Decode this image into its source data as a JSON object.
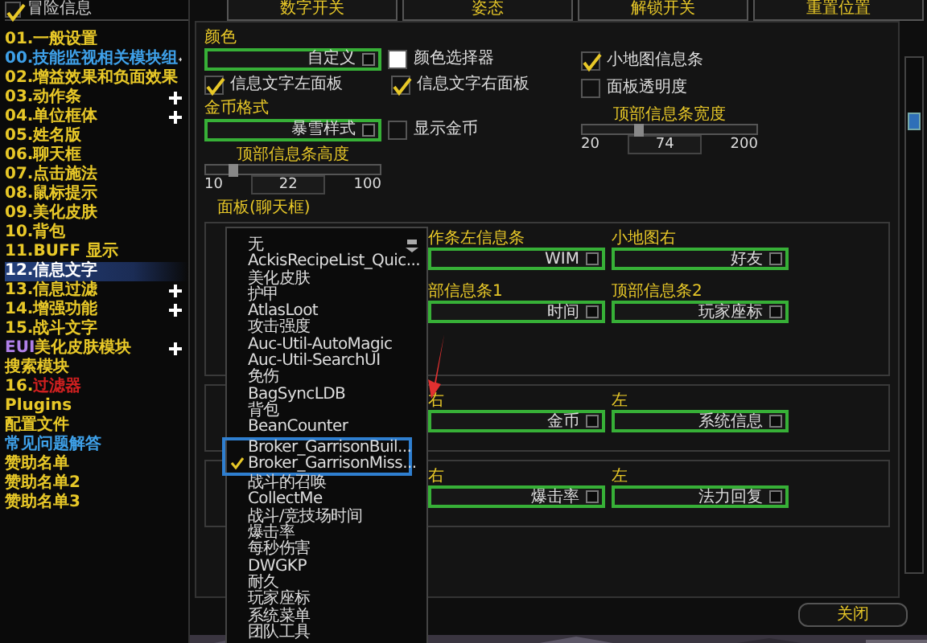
{
  "header": {
    "title": "冒险信息",
    "checked": true
  },
  "tabs": [
    {
      "label": "数字开关"
    },
    {
      "label": "姿态"
    },
    {
      "label": "解锁开关"
    },
    {
      "label": "重置位置"
    }
  ],
  "sidebar": {
    "items": [
      {
        "segments": [
          {
            "text": "01.一般设置",
            "color": "#e8c828"
          }
        ],
        "expandable": false,
        "selected": false
      },
      {
        "segments": [
          {
            "text": "00.技能监视相关模块组",
            "color": "#3ea0e8"
          }
        ],
        "expandable": true,
        "selected": false
      },
      {
        "segments": [
          {
            "text": "02.增益效果和负面效果",
            "color": "#e8c828"
          }
        ],
        "expandable": false,
        "selected": false
      },
      {
        "segments": [
          {
            "text": "03.动作条",
            "color": "#e8c828"
          }
        ],
        "expandable": true,
        "selected": false
      },
      {
        "segments": [
          {
            "text": "04.单位框体",
            "color": "#e8c828"
          }
        ],
        "expandable": true,
        "selected": false
      },
      {
        "segments": [
          {
            "text": "05.姓名版",
            "color": "#e8c828"
          }
        ],
        "expandable": false,
        "selected": false
      },
      {
        "segments": [
          {
            "text": "06.聊天框",
            "color": "#e8c828"
          }
        ],
        "expandable": false,
        "selected": false
      },
      {
        "segments": [
          {
            "text": "07.点击施法",
            "color": "#e8c828"
          }
        ],
        "expandable": false,
        "selected": false
      },
      {
        "segments": [
          {
            "text": "08.鼠标提示",
            "color": "#e8c828"
          }
        ],
        "expandable": false,
        "selected": false
      },
      {
        "segments": [
          {
            "text": "09.美化皮肤",
            "color": "#e8c828"
          }
        ],
        "expandable": false,
        "selected": false
      },
      {
        "segments": [
          {
            "text": "10.背包",
            "color": "#e8c828"
          }
        ],
        "expandable": false,
        "selected": false
      },
      {
        "segments": [
          {
            "text": "11.BUFF 显示",
            "color": "#e8c828"
          }
        ],
        "expandable": false,
        "selected": false
      },
      {
        "segments": [
          {
            "text": "12.信息文字"
          }
        ],
        "expandable": false,
        "selected": true
      },
      {
        "segments": [
          {
            "text": "13.信息过滤",
            "color": "#e8c828"
          }
        ],
        "expandable": true,
        "selected": false
      },
      {
        "segments": [
          {
            "text": "14.增强功能",
            "color": "#e8c828"
          }
        ],
        "expandable": true,
        "selected": false
      },
      {
        "segments": [
          {
            "text": "15.战斗文字",
            "color": "#e8c828"
          }
        ],
        "expandable": false,
        "selected": false
      },
      {
        "segments": [
          {
            "text": "EUI",
            "color": "#b080e8"
          },
          {
            "text": "美化皮肤模块",
            "color": "#e8c828"
          }
        ],
        "expandable": true,
        "selected": false
      },
      {
        "segments": [
          {
            "text": "搜索模块",
            "color": "#e8c828"
          }
        ],
        "expandable": false,
        "selected": false
      },
      {
        "segments": [
          {
            "text": "16.",
            "color": "#e8c828"
          },
          {
            "text": "过滤器",
            "color": "#d02020"
          }
        ],
        "expandable": false,
        "selected": false
      },
      {
        "segments": [
          {
            "text": "Plugins",
            "color": "#e8c828"
          }
        ],
        "expandable": false,
        "selected": false
      },
      {
        "segments": [
          {
            "text": "配置文件",
            "color": "#e8c828"
          }
        ],
        "expandable": false,
        "selected": false
      },
      {
        "segments": [
          {
            "text": "常见问题解答",
            "color": "#3ea0e8"
          }
        ],
        "expandable": false,
        "selected": false
      },
      {
        "segments": [
          {
            "text": "赞助名单",
            "color": "#e8c828"
          }
        ],
        "expandable": false,
        "selected": false
      },
      {
        "segments": [
          {
            "text": "赞助名单2",
            "color": "#e8c828"
          }
        ],
        "expandable": false,
        "selected": false
      },
      {
        "segments": [
          {
            "text": "赞助名单3",
            "color": "#e8c828"
          }
        ],
        "expandable": false,
        "selected": false
      }
    ]
  },
  "general": {
    "color_label": "颜色",
    "color_dropdown": "自定义",
    "color_picker": {
      "label": "颜色选择器",
      "color": "#ffffff"
    },
    "left_panel": {
      "label": "信息文字左面板",
      "checked": true
    },
    "right_panel": {
      "label": "信息文字右面板",
      "checked": true
    },
    "gold_label": "金币格式",
    "gold_dropdown": "暴雪样式",
    "show_gold": {
      "label": "显示金币",
      "checked": false
    },
    "minimap_bar": {
      "label": "小地图信息条",
      "checked": true
    },
    "panel_transparency": {
      "label": "面板透明度",
      "checked": false
    },
    "width_slider": {
      "label": "顶部信息条宽度",
      "min": "20",
      "max": "200",
      "value": "74",
      "level": 0.3
    },
    "height_slider": {
      "label": "顶部信息条高度",
      "min": "10",
      "max": "100",
      "value": "22",
      "level": 0.13
    }
  },
  "groups": [
    {
      "title": "面板(聊天框)",
      "rows": [
        [
          {
            "label": "作条左信息条",
            "value": "WIM"
          },
          {
            "label": "小地图右",
            "value": "好友"
          }
        ],
        [
          {
            "label": "部信息条1",
            "value": "时间"
          },
          {
            "label": "顶部信息条2",
            "value": "玩家座标"
          }
        ]
      ]
    },
    {
      "rows": [
        [
          {
            "label": "右",
            "value": "金币"
          },
          {
            "label": "左",
            "value": "系统信息"
          }
        ]
      ]
    },
    {
      "rows": [
        [
          {
            "label": "右",
            "value": "爆击率"
          },
          {
            "label": "左",
            "value": "法力回复"
          }
        ]
      ]
    }
  ],
  "close_button": "关闭",
  "menu": {
    "items": [
      {
        "label": "无",
        "checked": false
      },
      {
        "label": "AckisRecipeList_Quic...",
        "checked": false
      },
      {
        "label": "美化皮肤",
        "checked": false
      },
      {
        "label": "护甲",
        "checked": false
      },
      {
        "label": "AtlasLoot",
        "checked": false
      },
      {
        "label": "攻击强度",
        "checked": false
      },
      {
        "label": "Auc-Util-AutoMagic",
        "checked": false
      },
      {
        "label": "Auc-Util-SearchUI",
        "checked": false
      },
      {
        "label": "免伤",
        "checked": false
      },
      {
        "label": "BagSyncLDB",
        "checked": false
      },
      {
        "label": "背包",
        "checked": false
      },
      {
        "label": "BeanCounter",
        "checked": false
      },
      {
        "label": "Broker_GarrisonBuil...",
        "checked": false
      },
      {
        "label": "Broker_GarrisonMiss...",
        "checked": true
      },
      {
        "label": "战斗的召唤",
        "checked": false
      },
      {
        "label": "CollectMe",
        "checked": false
      },
      {
        "label": "战斗/竞技场时间",
        "checked": false
      },
      {
        "label": "爆击率",
        "checked": false
      },
      {
        "label": "每秒伤害",
        "checked": false
      },
      {
        "label": "DWGKP",
        "checked": false
      },
      {
        "label": "耐久",
        "checked": false
      },
      {
        "label": "玩家座标",
        "checked": false
      },
      {
        "label": "系统菜单",
        "checked": false
      },
      {
        "label": "团队工具",
        "checked": false
      }
    ]
  }
}
